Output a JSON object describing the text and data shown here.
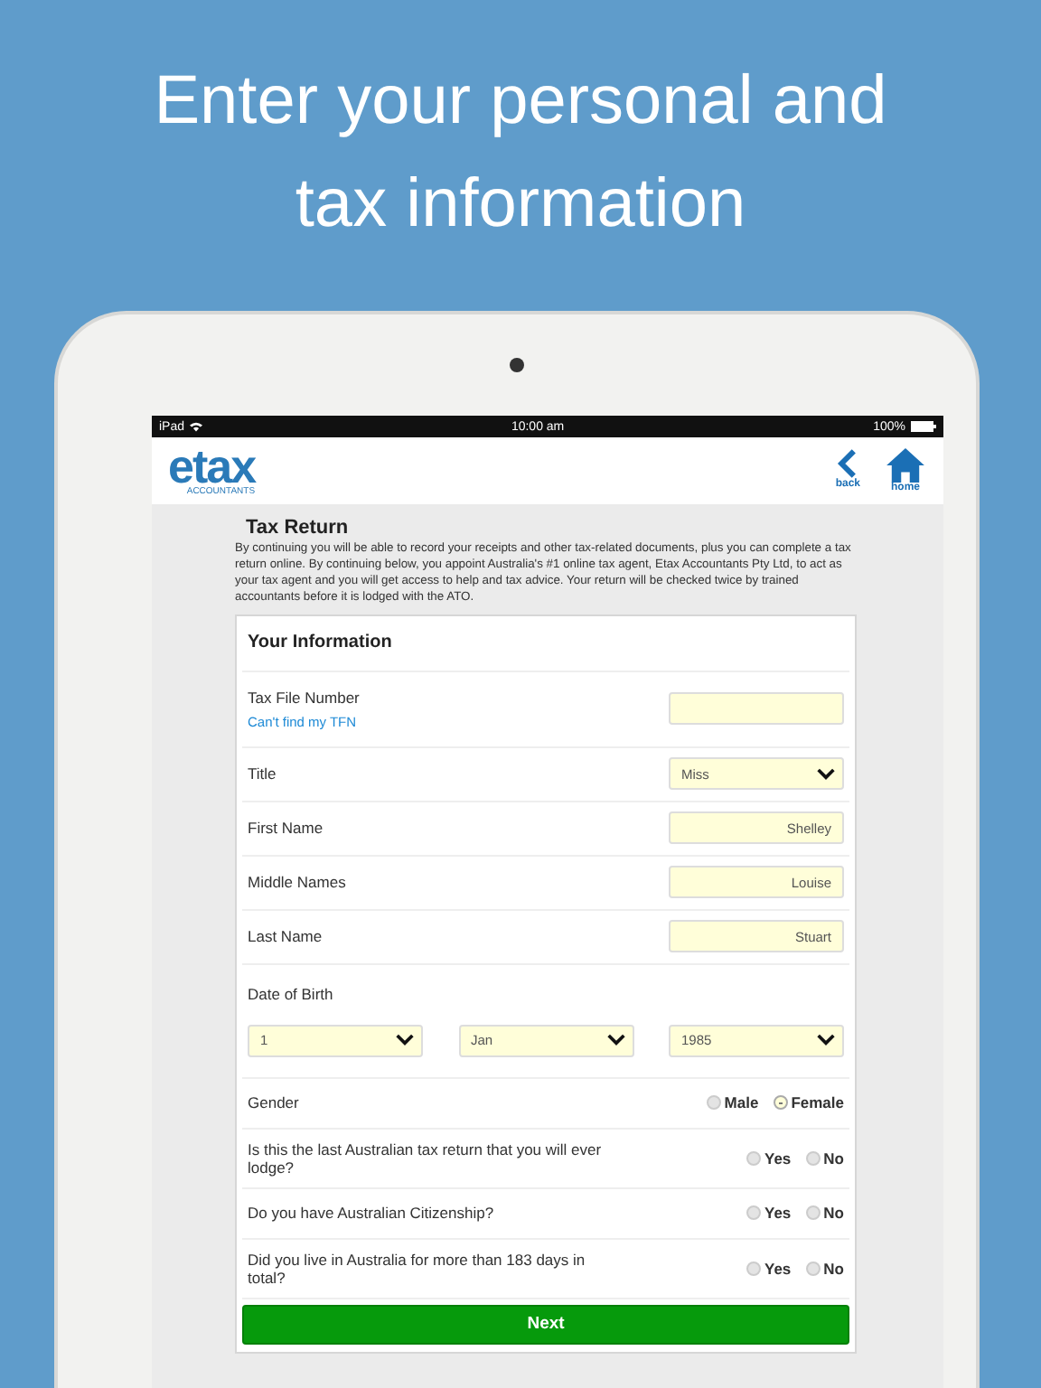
{
  "headline": "Enter your personal and tax information",
  "status_bar": {
    "device": "iPad",
    "time": "10:00 am",
    "battery": "100%"
  },
  "header": {
    "logo": "etax",
    "logo_subtitle": "ACCOUNTANTS",
    "nav": [
      {
        "kind": "back",
        "label": "back"
      },
      {
        "kind": "home",
        "label": "home"
      }
    ]
  },
  "page": {
    "title": "Tax Return",
    "intro": "By continuing you will be able to record your receipts and other tax-related documents, plus you can complete a tax return online. By continuing below, you appoint Australia's #1 online tax agent, Etax Accountants Pty Ltd, to act as your tax agent and you will get access to help and tax advice. Your return will be checked twice by trained accountants before it is lodged with the ATO."
  },
  "form": {
    "heading": "Your Information",
    "rows": [
      {
        "kind": "text",
        "label": "Tax File Number",
        "link": "Can't find my TFN"
      },
      {
        "kind": "select",
        "label": "Title",
        "value": "Miss"
      },
      {
        "kind": "text",
        "label": "First Name",
        "value": "Shelley"
      },
      {
        "kind": "text",
        "label": "Middle Names",
        "value": "Louise"
      },
      {
        "kind": "text",
        "label": "Last Name",
        "value": "Stuart"
      },
      {
        "kind": "date",
        "label": "Date of Birth",
        "selects": [
          "1",
          "Jan",
          "1985"
        ]
      },
      {
        "kind": "radio",
        "label": "Gender",
        "options": [
          {
            "label": "Male",
            "selected": false
          },
          {
            "label": "Female",
            "selected": true
          }
        ]
      },
      {
        "kind": "radio",
        "label": "Is this the last Australian tax return that you will ever lodge?",
        "options": [
          {
            "label": "Yes",
            "selected": false
          },
          {
            "label": "No",
            "selected": false
          }
        ]
      },
      {
        "kind": "radio",
        "label": "Do you have Australian Citizenship?",
        "options": [
          {
            "label": "Yes",
            "selected": false
          },
          {
            "label": "No",
            "selected": false
          }
        ]
      },
      {
        "kind": "radio",
        "label": "Did you live in Australia for more than 183 days in total?",
        "options": [
          {
            "label": "Yes",
            "selected": false
          },
          {
            "label": "No",
            "selected": false
          }
        ]
      }
    ],
    "next_button": "Next"
  }
}
